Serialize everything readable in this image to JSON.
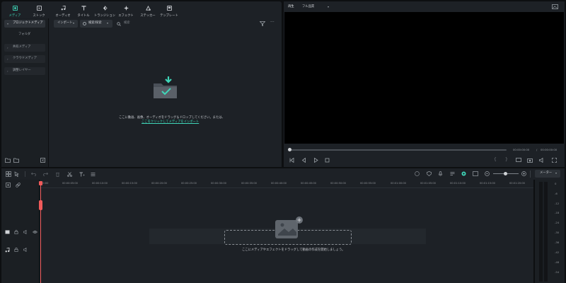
{
  "toolbar": {
    "tabs": [
      {
        "label": "メディア",
        "icon": "media-icon",
        "active": true
      },
      {
        "label": "ストック",
        "icon": "stock-icon"
      },
      {
        "label": "オーディオ",
        "icon": "music-note-icon"
      },
      {
        "label": "タイトル",
        "icon": "title-T-icon"
      },
      {
        "label": "トランジション",
        "icon": "transition-icon"
      },
      {
        "label": "エフェクト",
        "icon": "effect-sparkle-icon"
      },
      {
        "label": "ステッカー",
        "icon": "sticker-icon"
      },
      {
        "label": "テンプレート",
        "icon": "template-icon"
      }
    ]
  },
  "sidebar": {
    "project_media": "プロジェクトメディア",
    "folder": "フォルダ",
    "items": [
      "共有メディア",
      "クラウドメディア",
      "調整レイヤー"
    ]
  },
  "media": {
    "import_label": "インポート",
    "sort_label": "検索/探索",
    "search_placeholder": "検索",
    "empty_line1": "ここに動画、画像、オーディオをドラッグ＆ドロップしてください。または、",
    "empty_link": "ここをクリックしてメディアをインポート"
  },
  "player": {
    "tab_label": "再生",
    "quality": "フル品質",
    "time_current": "00:00:00:00",
    "time_separator": "/",
    "time_total": "00:00:00:00"
  },
  "timeline": {
    "ruler_ticks": [
      "00:00",
      "00:00:05:00",
      "00:00:10:00",
      "00:00:15:00",
      "00:00:20:00",
      "00:00:25:00",
      "00:00:30:00",
      "00:00:35:00",
      "00:00:40:00",
      "00:00:45:00",
      "00:00:50:00",
      "00:00:55:00",
      "00:01:00:00",
      "00:01:05:00",
      "00:01:10:00",
      "00:01:15:00",
      "00:01:20:00"
    ],
    "drop_hint": "ここにメディアやエフェクトをドラッグして動画の作成を開始しましょう。",
    "meter_label": "メーター",
    "meter_scale": [
      "0",
      "-6",
      "-12",
      "-18",
      "-24",
      "-30",
      "-36",
      "-42",
      "-48",
      "-54"
    ]
  },
  "colors": {
    "accent": "#3fd6b8",
    "playhead": "#f05a5a",
    "panel": "#1d2126",
    "background": "#0d0f11"
  }
}
